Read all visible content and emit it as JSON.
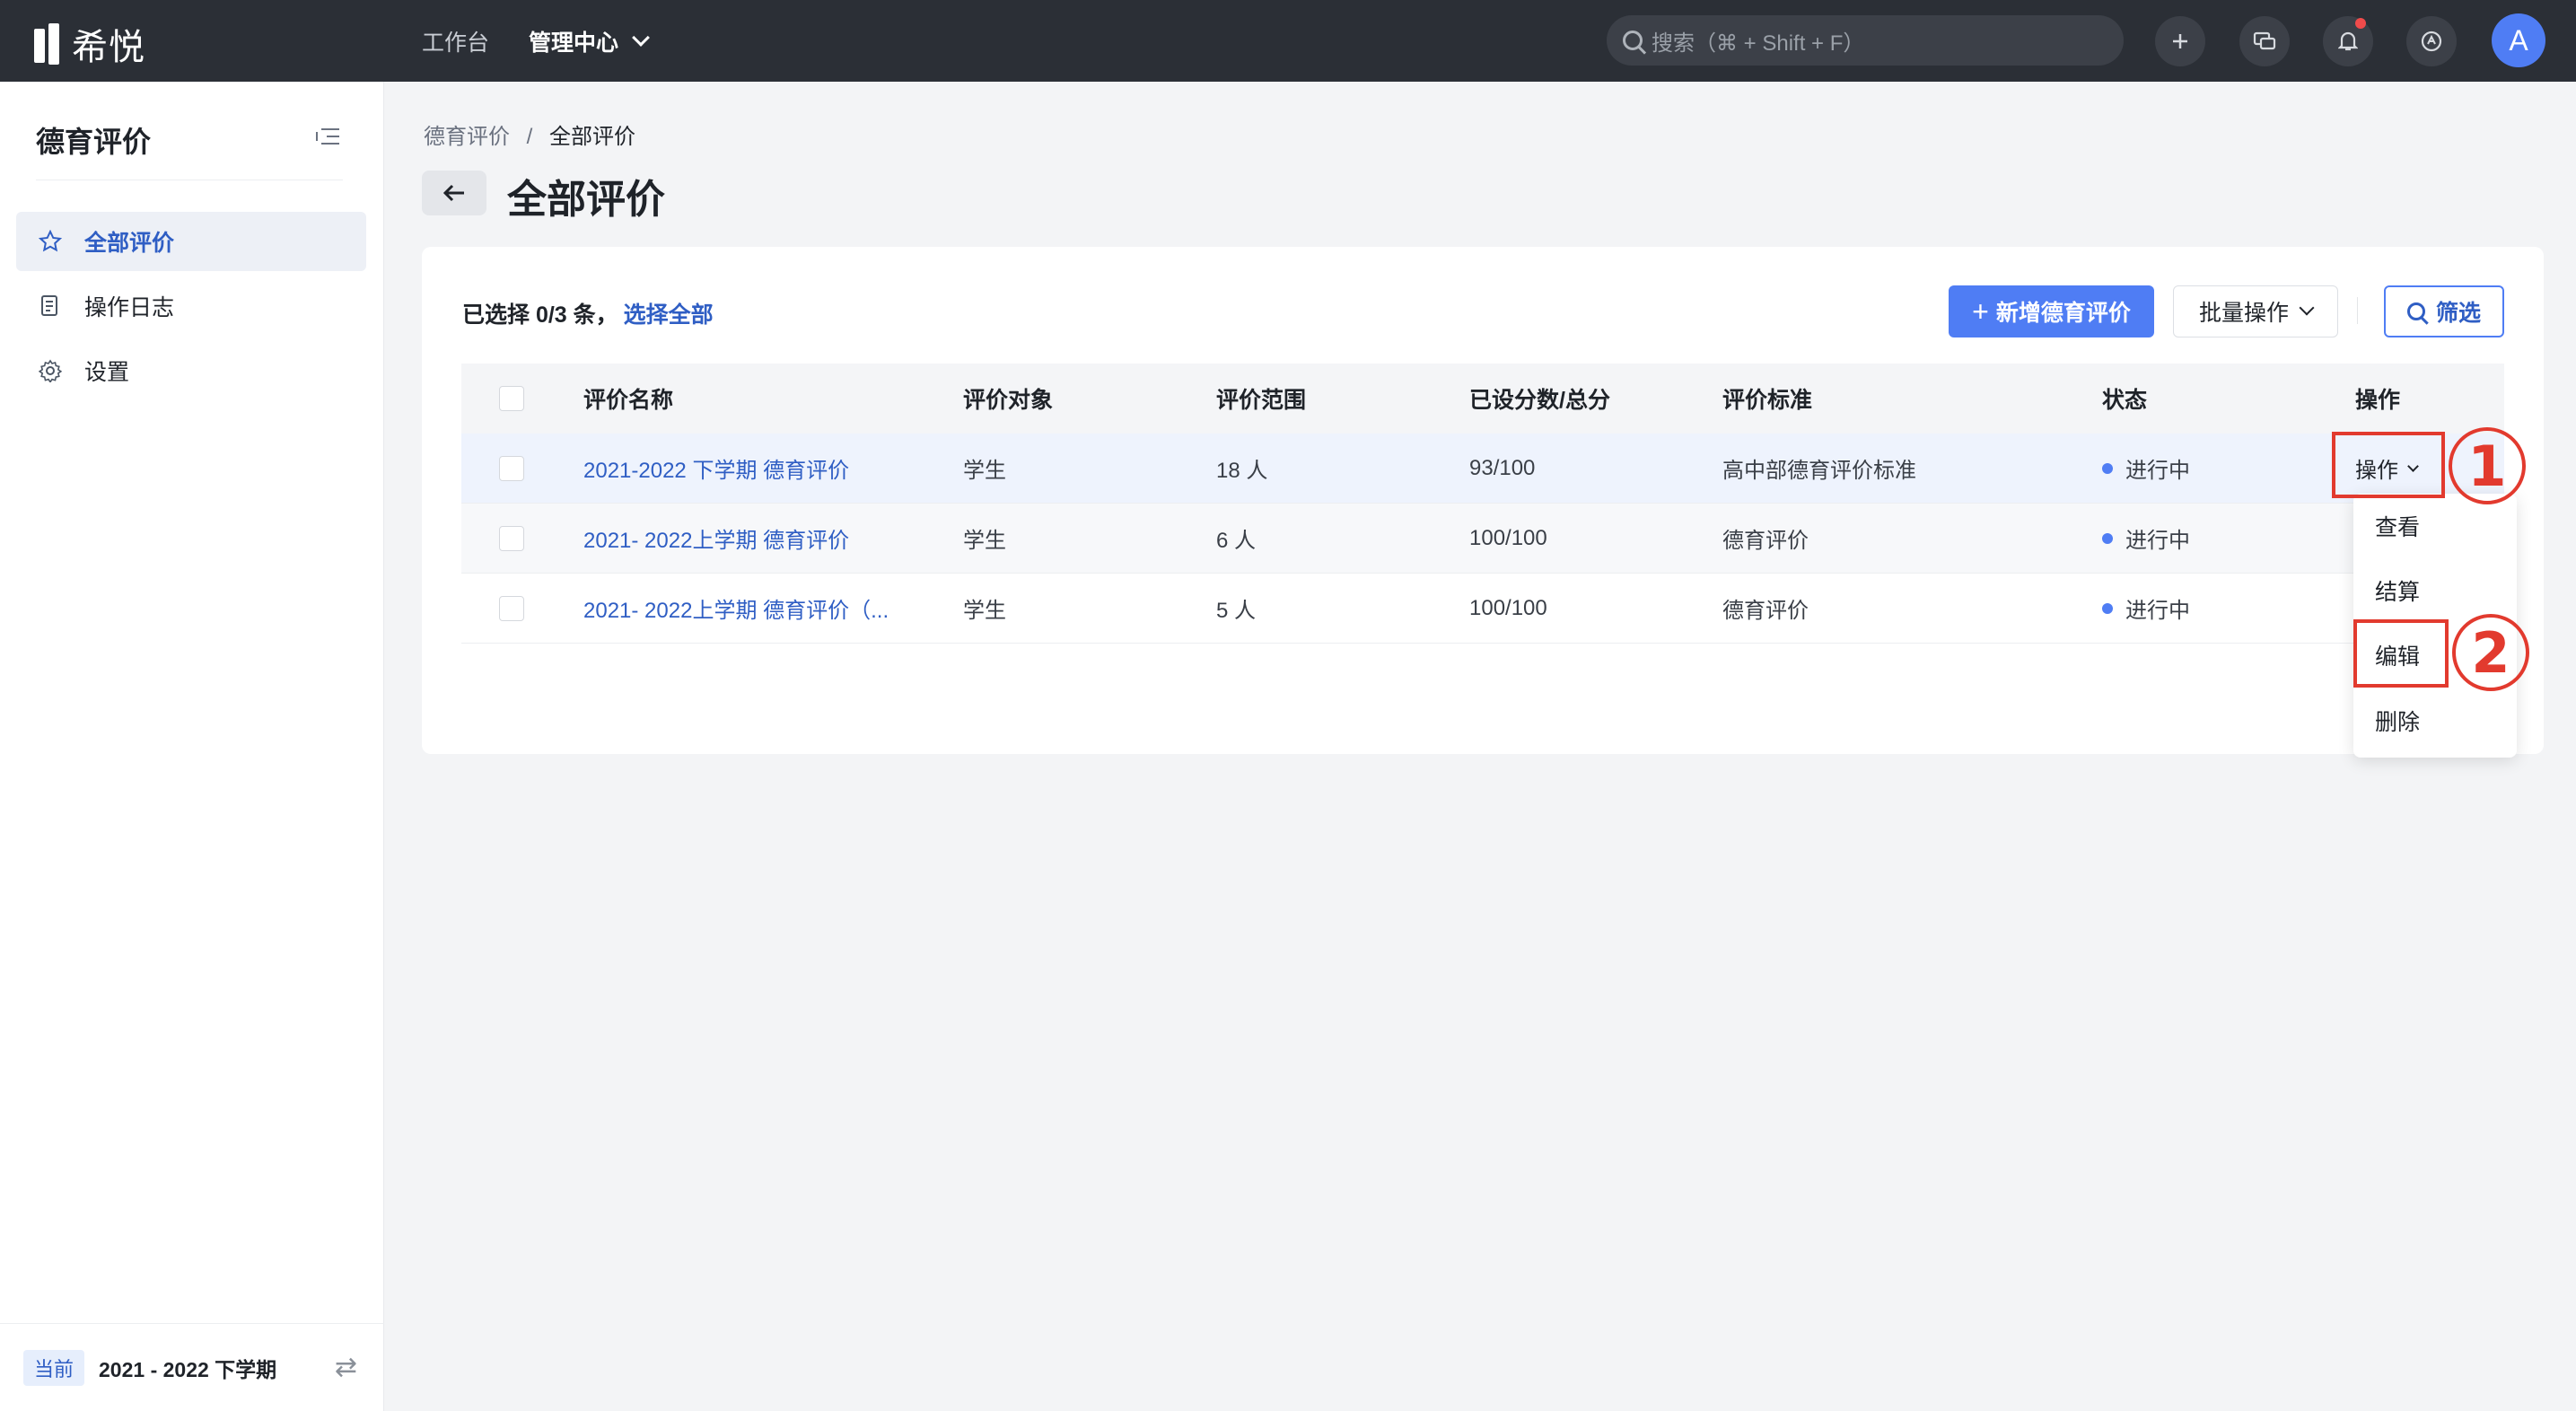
{
  "topbar": {
    "logo_text": "希悦",
    "nav": [
      {
        "label": "工作台"
      },
      {
        "label": "管理中心"
      }
    ],
    "search_placeholder": "搜索（⌘ + Shift + F）",
    "icons": [
      "plus-icon",
      "chat-icon",
      "bell-icon",
      "help-icon"
    ],
    "avatar_letter": "A",
    "notification_dot_color": "#f04b4b"
  },
  "sidebar": {
    "title": "德育评价",
    "items": [
      {
        "label": "全部评价",
        "icon": "star-icon",
        "active": true
      },
      {
        "label": "操作日志",
        "icon": "document-icon",
        "active": false
      },
      {
        "label": "设置",
        "icon": "gear-icon",
        "active": false
      }
    ],
    "footer": {
      "tag": "当前",
      "term": "2021 - 2022 下学期"
    }
  },
  "breadcrumb": {
    "parent": "德育评价",
    "separator": "/",
    "current": "全部评价"
  },
  "page": {
    "title": "全部评价"
  },
  "toolbar": {
    "selection_text": "已选择 0/3 条，",
    "select_all_link": "选择全部",
    "add_button": "新增德育评价",
    "batch_button": "批量操作",
    "filter_button": "筛选"
  },
  "table": {
    "headers": [
      "评价名称",
      "评价对象",
      "评价范围",
      "已设分数/总分",
      "评价标准",
      "状态",
      "操作"
    ],
    "rows": [
      {
        "name": "2021-2022 下学期 德育评价",
        "target": "学生",
        "range": "18 人",
        "score": "93/100",
        "standard": "高中部德育评价标准",
        "status": "进行中",
        "op": "操作"
      },
      {
        "name": "2021- 2022上学期 德育评价",
        "target": "学生",
        "range": "6 人",
        "score": "100/100",
        "standard": "德育评价",
        "status": "进行中",
        "op": ""
      },
      {
        "name": "2021- 2022上学期 德育评价（...",
        "target": "学生",
        "range": "5 人",
        "score": "100/100",
        "standard": "德育评价",
        "status": "进行中",
        "op": ""
      }
    ]
  },
  "dropdown": {
    "items": [
      "查看",
      "结算",
      "编辑",
      "删除"
    ]
  },
  "annotations": {
    "step1": "1",
    "step2": "2",
    "color": "#e23a2e"
  },
  "colors": {
    "primary": "#4f7df4",
    "link": "#2f5ec4",
    "topbar": "#2b2f36"
  }
}
